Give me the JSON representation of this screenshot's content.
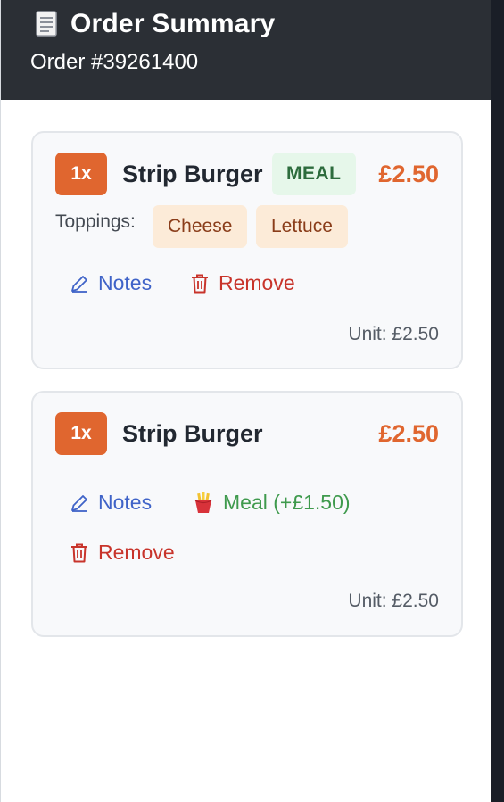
{
  "header": {
    "icon": "receipt-icon",
    "title": "Order Summary",
    "order_number": "Order #39261400"
  },
  "items": [
    {
      "quantity": "1x",
      "name": "Strip Burger",
      "badge": "MEAL",
      "price": "£2.50",
      "toppings_label": "Toppings:",
      "toppings": [
        "Cheese",
        "Lettuce"
      ],
      "notes_label": "Notes",
      "remove_label": "Remove",
      "unit_price": "Unit: £2.50"
    },
    {
      "quantity": "1x",
      "name": "Strip Burger",
      "price": "£2.50",
      "notes_label": "Notes",
      "meal_label": "Meal (+£1.50)",
      "remove_label": "Remove",
      "unit_price": "Unit: £2.50"
    }
  ],
  "colors": {
    "header_bg": "#2b2f35",
    "accent": "#e0662f",
    "notes": "#3f63c8",
    "remove": "#c8342b",
    "meal": "#3f9a4d"
  }
}
